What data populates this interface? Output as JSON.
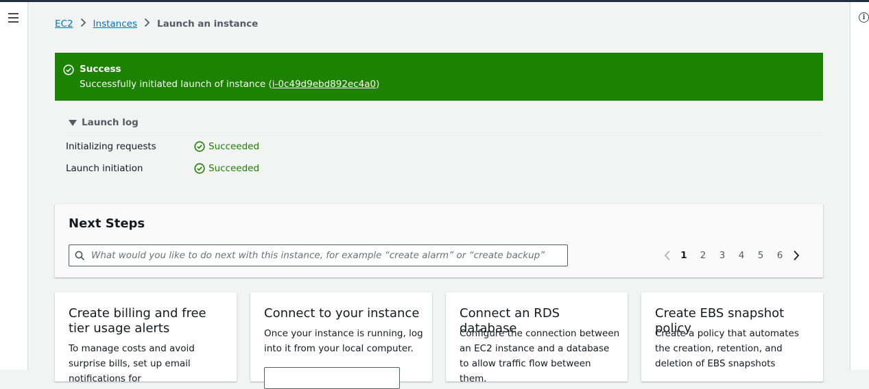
{
  "breadcrumb": {
    "items": [
      "EC2",
      "Instances"
    ],
    "current": "Launch an instance"
  },
  "flash": {
    "title": "Success",
    "message_prefix": "Successfully initiated launch of instance (",
    "instance_id": "i-0c49d9ebd892ec4a0",
    "message_suffix": ")",
    "color": "#1d8102"
  },
  "launch_log": {
    "heading": "Launch log",
    "rows": [
      {
        "label": "Initializing requests",
        "status": "Succeeded"
      },
      {
        "label": "Launch initiation",
        "status": "Succeeded"
      }
    ]
  },
  "next_steps": {
    "title": "Next Steps",
    "search_placeholder": "What would you like to do next with this instance, for example “create alarm” or “create backup”",
    "pages": [
      "1",
      "2",
      "3",
      "4",
      "5",
      "6"
    ],
    "current_page": "1"
  },
  "cards": [
    {
      "title": "Create billing and free tier usage alerts",
      "body": "To manage costs and avoid surprise bills, set up email notifications for"
    },
    {
      "title": "Connect to your instance",
      "body": "Once your instance is running, log into it from your local computer."
    },
    {
      "title": "Connect an RDS database",
      "body": "Configure the connection between an EC2 instance and a database to allow traffic flow between them."
    },
    {
      "title": "Create EBS snapshot policy",
      "body": "Create a policy that automates the creation, retention, and deletion of EBS snapshots"
    }
  ],
  "icons": {
    "nav": "hamburger-menu-icon",
    "info": "info-icon",
    "status": "check-circle-icon",
    "search": "search-icon"
  }
}
